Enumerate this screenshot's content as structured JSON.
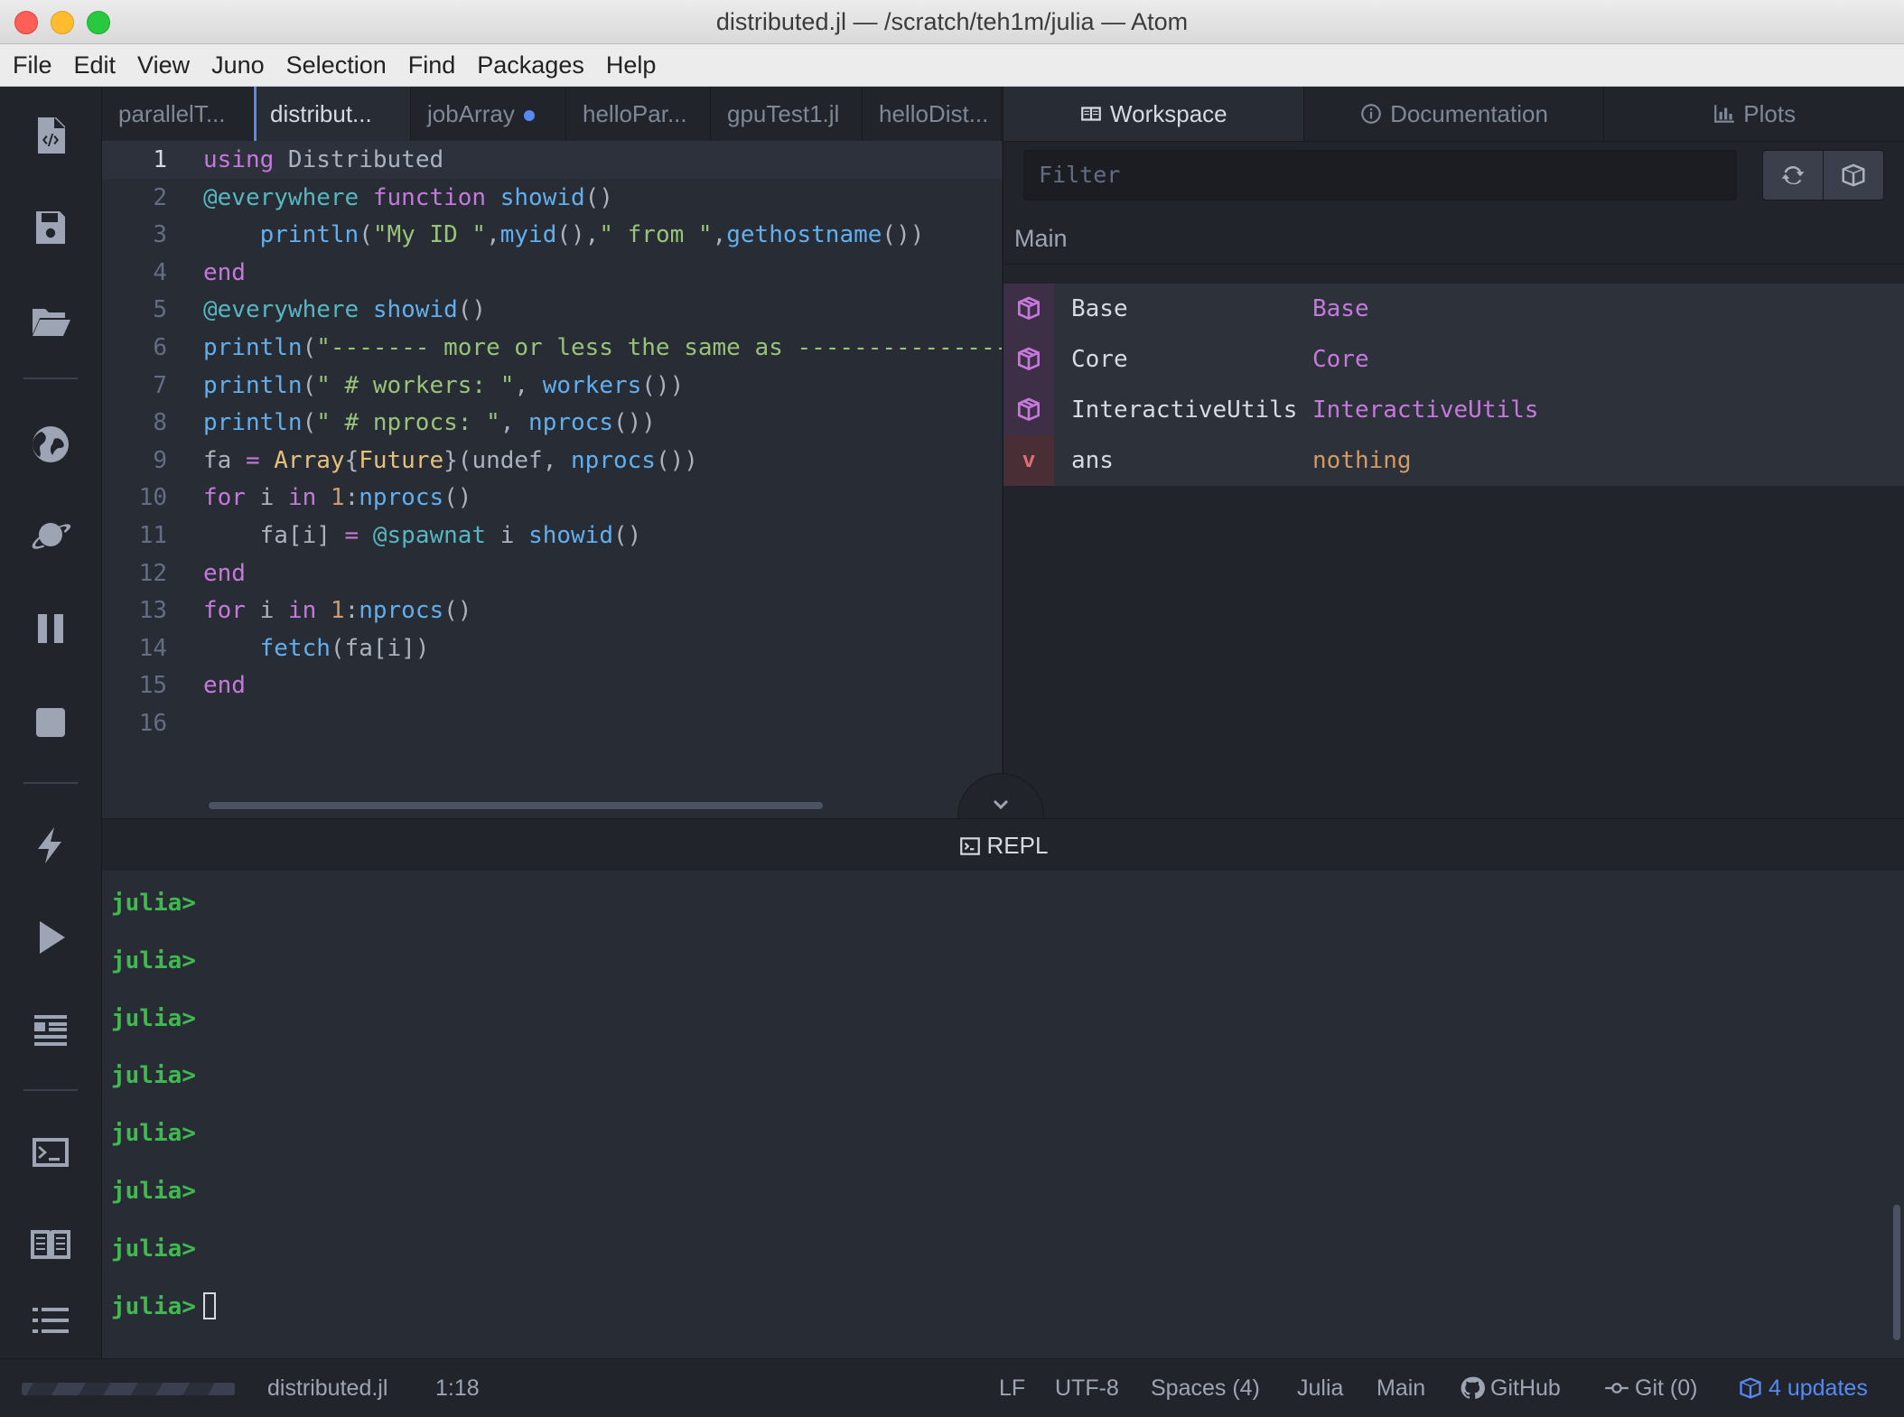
{
  "window": {
    "title": "distributed.jl — /scratch/teh1m/julia — Atom"
  },
  "menu": [
    "File",
    "Edit",
    "View",
    "Juno",
    "Selection",
    "Find",
    "Packages",
    "Help"
  ],
  "toolbar_icons": [
    "file-code-icon",
    "save-icon",
    "folder-open-icon",
    "globe-icon",
    "planet-icon",
    "pause-icon",
    "stop-icon",
    "lightning-icon",
    "play-icon",
    "format-icon",
    "terminal-icon",
    "book-icon",
    "list-icon"
  ],
  "editor": {
    "tabs": [
      {
        "label": "parallelT...",
        "active": false,
        "modified": false
      },
      {
        "label": "distribut...",
        "active": true,
        "modified": false
      },
      {
        "label": "jobArray",
        "active": false,
        "modified": true
      },
      {
        "label": "helloPar...",
        "active": false,
        "modified": false
      },
      {
        "label": "gpuTest1.jl",
        "active": false,
        "modified": false
      },
      {
        "label": "helloDist...",
        "active": false,
        "modified": false
      }
    ],
    "line_numbers": [
      "1",
      "2",
      "3",
      "4",
      "5",
      "6",
      "7",
      "8",
      "9",
      "10",
      "11",
      "12",
      "13",
      "14",
      "15",
      "16"
    ],
    "lines": [
      [
        [
          "kw",
          "using"
        ],
        [
          "pl",
          " Distributed"
        ]
      ],
      [
        [
          "ma",
          "@everywhere"
        ],
        [
          "pl",
          " "
        ],
        [
          "kw",
          "function"
        ],
        [
          "pl",
          " "
        ],
        [
          "fn",
          "showid"
        ],
        [
          "pl",
          "()"
        ]
      ],
      [
        [
          "pl",
          "    "
        ],
        [
          "fn",
          "println"
        ],
        [
          "pl",
          "("
        ],
        [
          "st",
          "\"My ID \""
        ],
        [
          "pl",
          ","
        ],
        [
          "fn",
          "myid"
        ],
        [
          "pl",
          "(),"
        ],
        [
          "st",
          "\" from \""
        ],
        [
          "pl",
          ","
        ],
        [
          "fn",
          "gethostname"
        ],
        [
          "pl",
          "())"
        ]
      ],
      [
        [
          "kw",
          "end"
        ]
      ],
      [
        [
          "ma",
          "@everywhere"
        ],
        [
          "pl",
          " "
        ],
        [
          "fn",
          "showid"
        ],
        [
          "pl",
          "()"
        ]
      ],
      [
        [
          "fn",
          "println"
        ],
        [
          "pl",
          "("
        ],
        [
          "st",
          "\"------- more or less the same as ----------------"
        ]
      ],
      [
        [
          "fn",
          "println"
        ],
        [
          "pl",
          "("
        ],
        [
          "st",
          "\" # workers: \""
        ],
        [
          "pl",
          ", "
        ],
        [
          "fn",
          "workers"
        ],
        [
          "pl",
          "())"
        ]
      ],
      [
        [
          "fn",
          "println"
        ],
        [
          "pl",
          "("
        ],
        [
          "st",
          "\" # nprocs: \""
        ],
        [
          "pl",
          ", "
        ],
        [
          "fn",
          "nprocs"
        ],
        [
          "pl",
          "())"
        ]
      ],
      [
        [
          "pl",
          "fa "
        ],
        [
          "kw",
          "="
        ],
        [
          "pl",
          " "
        ],
        [
          "ty",
          "Array"
        ],
        [
          "pl",
          "{"
        ],
        [
          "ty",
          "Future"
        ],
        [
          "pl",
          "}(undef, "
        ],
        [
          "fn",
          "nprocs"
        ],
        [
          "pl",
          "())"
        ]
      ],
      [
        [
          "kw",
          "for"
        ],
        [
          "pl",
          " i "
        ],
        [
          "kw",
          "in"
        ],
        [
          "pl",
          " "
        ],
        [
          "nm",
          "1"
        ],
        [
          "pl",
          ":"
        ],
        [
          "fn",
          "nprocs"
        ],
        [
          "pl",
          "()"
        ]
      ],
      [
        [
          "pl",
          "    fa[i] "
        ],
        [
          "kw",
          "="
        ],
        [
          "pl",
          " "
        ],
        [
          "ma",
          "@spawnat"
        ],
        [
          "pl",
          " i "
        ],
        [
          "fn",
          "showid"
        ],
        [
          "pl",
          "()"
        ]
      ],
      [
        [
          "kw",
          "end"
        ]
      ],
      [
        [
          "kw",
          "for"
        ],
        [
          "pl",
          " i "
        ],
        [
          "kw",
          "in"
        ],
        [
          "pl",
          " "
        ],
        [
          "nm",
          "1"
        ],
        [
          "pl",
          ":"
        ],
        [
          "fn",
          "nprocs"
        ],
        [
          "pl",
          "()"
        ]
      ],
      [
        [
          "pl",
          "    "
        ],
        [
          "fn",
          "fetch"
        ],
        [
          "pl",
          "(fa[i])"
        ]
      ],
      [
        [
          "kw",
          "end"
        ]
      ],
      []
    ]
  },
  "right_panel": {
    "tabs": [
      {
        "label": "Workspace",
        "icon": "workspace-icon",
        "active": true
      },
      {
        "label": "Documentation",
        "icon": "info-icon",
        "active": false
      },
      {
        "label": "Plots",
        "icon": "plots-icon",
        "active": false
      }
    ],
    "filter_placeholder": "Filter",
    "module": "Main",
    "rows": [
      {
        "kind": "module",
        "name": "Base",
        "value": "Base",
        "color": "#c678dd"
      },
      {
        "kind": "module",
        "name": "Core",
        "value": "Core",
        "color": "#c678dd"
      },
      {
        "kind": "module",
        "name": "InteractiveUtils",
        "value": "InteractiveUtils",
        "color": "#c678dd"
      },
      {
        "kind": "var",
        "badge": "v",
        "name": "ans",
        "value": "nothing",
        "color": "#d19a66"
      }
    ]
  },
  "repl": {
    "title": "REPL",
    "prompts": [
      "julia>",
      "julia>",
      "julia>",
      "julia>",
      "julia>",
      "julia>",
      "julia>",
      "julia>"
    ]
  },
  "status": {
    "file": "distributed.jl",
    "cursor": "1:18",
    "line_ending": "LF",
    "encoding": "UTF-8",
    "indent": "Spaces (4)",
    "grammar": "Julia",
    "module": "Main",
    "github": "GitHub",
    "git": "Git (0)",
    "updates": "4 updates"
  },
  "colors": {
    "accent": "#568af2",
    "prompt": "#3fb950",
    "module": "#c678dd",
    "value": "#d19a66"
  }
}
